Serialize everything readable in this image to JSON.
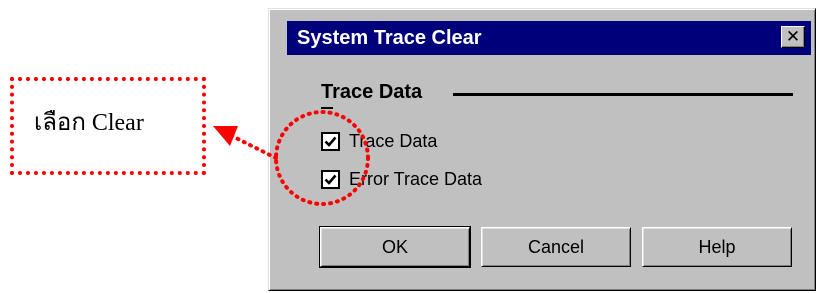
{
  "annotation": {
    "callout_text": "เลือก Clear",
    "color": "#ff0000"
  },
  "dialog": {
    "title": "System Trace Clear",
    "close_glyph": "✕",
    "close_icon": "close-icon",
    "title_bar_color": "#00007b",
    "face_color": "#c0c0c0",
    "group": {
      "label": "Trace Data",
      "checkboxes": [
        {
          "label": "Trace Data",
          "checked": true
        },
        {
          "label": "Error Trace Data",
          "checked": true
        }
      ]
    },
    "buttons": {
      "ok": "OK",
      "cancel": "Cancel",
      "help": "Help"
    }
  }
}
